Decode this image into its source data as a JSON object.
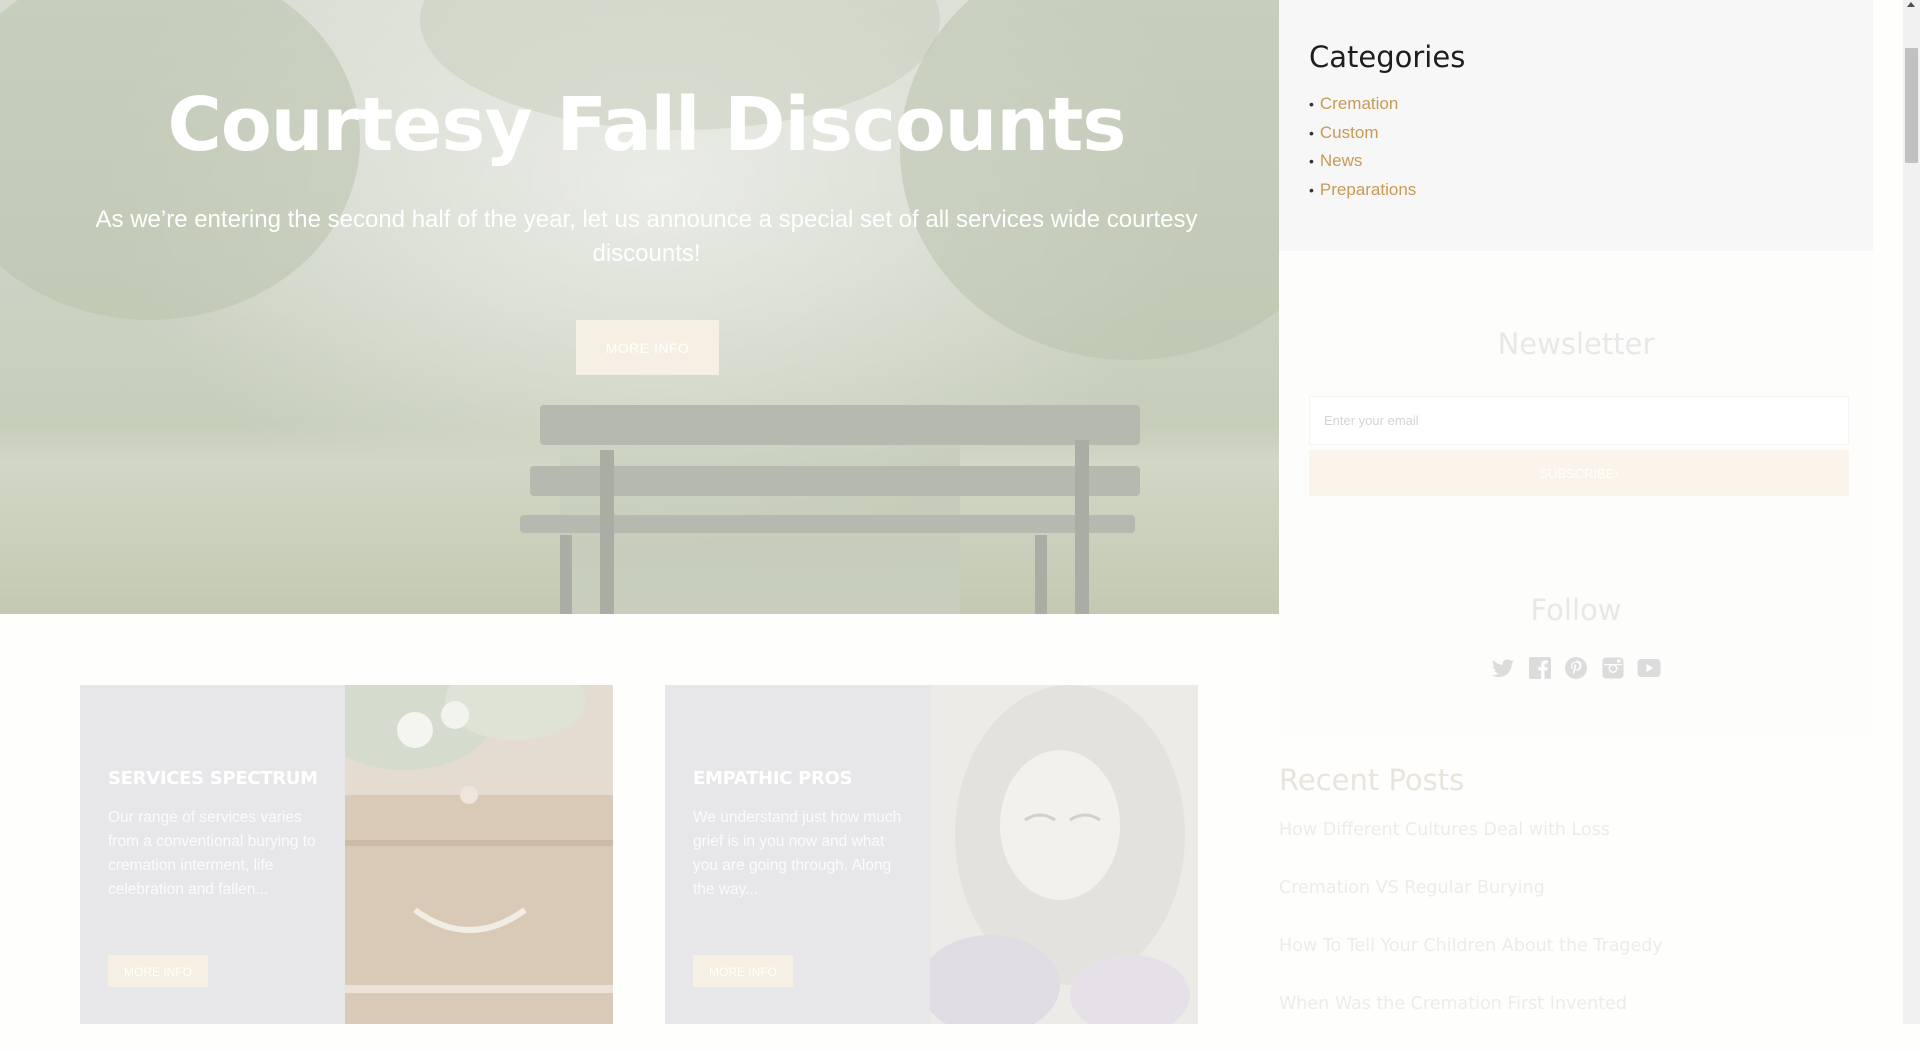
{
  "hero": {
    "title": "Courtesy Fall Discounts",
    "subtitle": "As we’re entering the second half of the year, let us announce a special set of all services wide courtesy discounts!",
    "button": "MORE INFO"
  },
  "cards": [
    {
      "title": "SERVICES SPECTRUM",
      "text": "Our range of services varies from a conventional burying to cremation interment, life celebration and fallen...",
      "button": "MORE INFO"
    },
    {
      "title": "EMPATHIC PROS",
      "text": "We understand just how much grief is in you now and what you are going through. Along the way...",
      "button": "MORE INFO"
    }
  ],
  "sidebar": {
    "categories": {
      "title": "Categories",
      "items": [
        "Cremation",
        "Custom",
        "News",
        "Preparations"
      ]
    },
    "newsletter": {
      "title": "Newsletter",
      "placeholder": "Enter your email",
      "button": "SUBSCRIBE›"
    },
    "follow": {
      "title": "Follow",
      "icons": [
        "twitter-icon",
        "facebook-icon",
        "pinterest-icon",
        "instagram-icon",
        "youtube-icon"
      ]
    },
    "recent": {
      "title": "Recent Posts",
      "items": [
        "How Different Cultures Deal with Loss",
        "Cremation VS Regular Burying",
        "How To Tell Your Children About the Tragedy",
        "When Was the Cremation First Invented"
      ]
    }
  },
  "colors": {
    "accent_link": "#c99a55",
    "button_bg": "#f6efe3",
    "card_panel": "#e7e7e9"
  }
}
